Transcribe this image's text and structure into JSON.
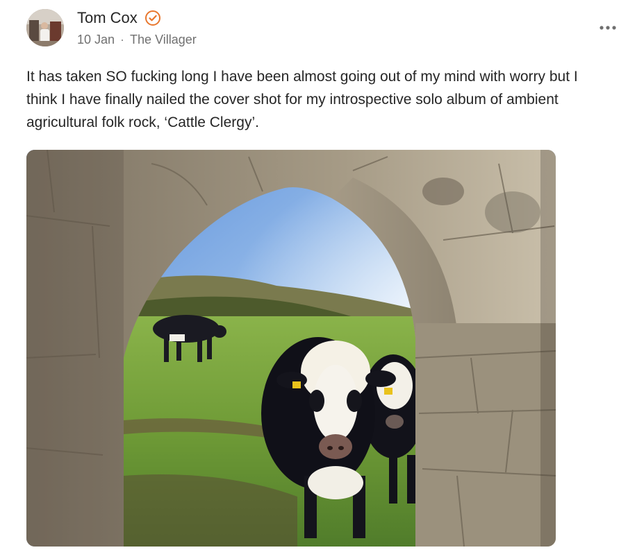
{
  "post": {
    "author": {
      "name": "Tom Cox",
      "verified_icon": "verified-check-icon",
      "accent_color": "#E8772E"
    },
    "date": "10 Jan",
    "separator": "·",
    "publication": "The Villager",
    "more_icon": "more-horizontal-icon",
    "text": "It has taken SO fucking long I have been almost going out of my mind with worry but I think I have finally nailed the cover shot for my introspective solo album of ambient agricultural folk rock, ‘Cattle Clergy’.",
    "image": {
      "subject": "cows-through-stone-arch-photo"
    }
  }
}
